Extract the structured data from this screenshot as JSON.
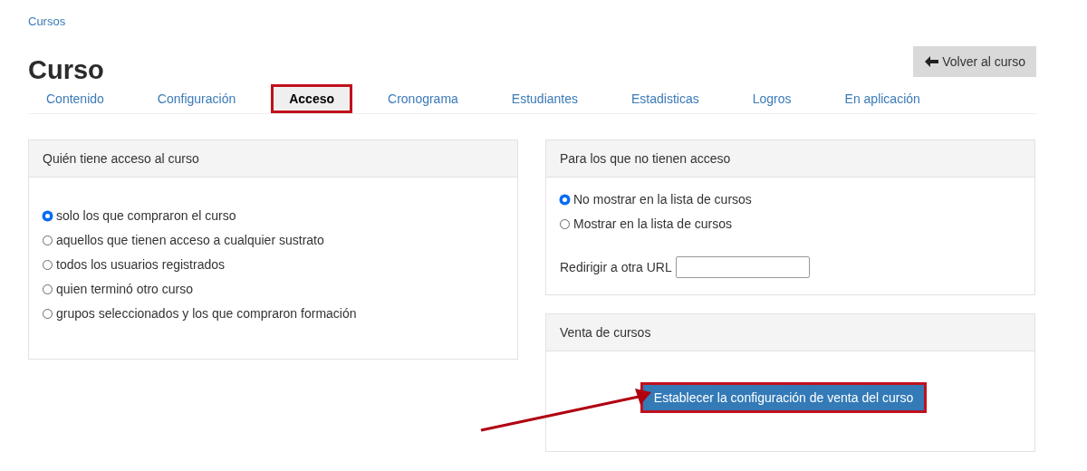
{
  "breadcrumb": "Cursos",
  "title": "Curso",
  "back_button": {
    "label": "Volver al curso"
  },
  "tabs": [
    {
      "label": "Contenido",
      "selected": false
    },
    {
      "label": "Configuración",
      "selected": false
    },
    {
      "label": "Acceso",
      "selected": true
    },
    {
      "label": "Cronograma",
      "selected": false
    },
    {
      "label": "Estudiantes",
      "selected": false
    },
    {
      "label": "Estadisticas",
      "selected": false
    },
    {
      "label": "Logros",
      "selected": false
    },
    {
      "label": "En aplicación",
      "selected": false
    }
  ],
  "access_panel": {
    "title": "Quién tiene acceso al curso",
    "options": [
      {
        "label": "solo los que compraron el curso",
        "selected": true
      },
      {
        "label": "aquellos que tienen acceso a cualquier sustrato",
        "selected": false
      },
      {
        "label": "todos los usuarios registrados",
        "selected": false
      },
      {
        "label": "quien terminó otro curso",
        "selected": false
      },
      {
        "label": "grupos seleccionados y los que compraron formación",
        "selected": false
      }
    ]
  },
  "no_access_panel": {
    "title": "Para los que no tienen acceso",
    "options": [
      {
        "label": "No mostrar en la lista de cursos",
        "selected": true
      },
      {
        "label": "Mostrar en la lista de cursos",
        "selected": false
      }
    ],
    "redirect_label": "Redirigir a otra URL"
  },
  "sales_panel": {
    "title": "Venta de cursos",
    "button": {
      "label": "Establecer la configuración de venta del curso",
      "highlighted": true
    }
  }
}
